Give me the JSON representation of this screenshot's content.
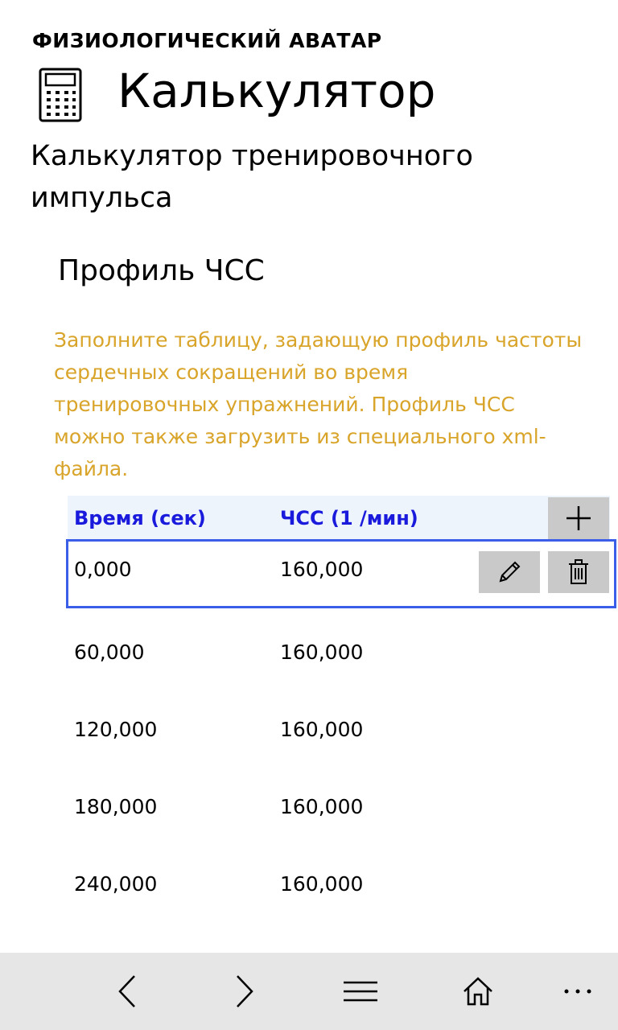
{
  "app": {
    "name": "ФИЗИОЛОГИЧЕСКИЙ АВАТАР"
  },
  "header": {
    "title": "Калькулятор",
    "icon": "calculator-icon"
  },
  "subtitle": {
    "line1": "Калькулятор тренировочного",
    "line2": "импульса"
  },
  "section": {
    "title": "Профиль ЧСС"
  },
  "hint": {
    "line1": "Заполните таблицу, задающую профиль частоты",
    "line2": "сердечных сокращений во время",
    "line3": "тренировочных упражнений. Профиль ЧСС",
    "line4": "можно также загрузить из специального xml-",
    "line5": "файла.",
    "color": "#d9a42a"
  },
  "table": {
    "columns": [
      "Время (сек)",
      "ЧСС (1 /мин)"
    ],
    "header_color": "#1a1add",
    "add_icon": "plus-icon",
    "rows": [
      {
        "time": "0,000",
        "hr": "160,000"
      },
      {
        "time": "60,000",
        "hr": "160,000"
      },
      {
        "time": "120,000",
        "hr": "160,000"
      },
      {
        "time": "180,000",
        "hr": "160,000"
      },
      {
        "time": "240,000",
        "hr": "160,000"
      }
    ],
    "selected_row_index": 0,
    "edit_icon": "pencil-icon",
    "delete_icon": "trash-icon"
  },
  "bottom_bar": {
    "items": [
      "back-icon",
      "forward-icon",
      "menu-icon",
      "home-icon",
      "more-icon"
    ],
    "more_glyph": "···"
  }
}
